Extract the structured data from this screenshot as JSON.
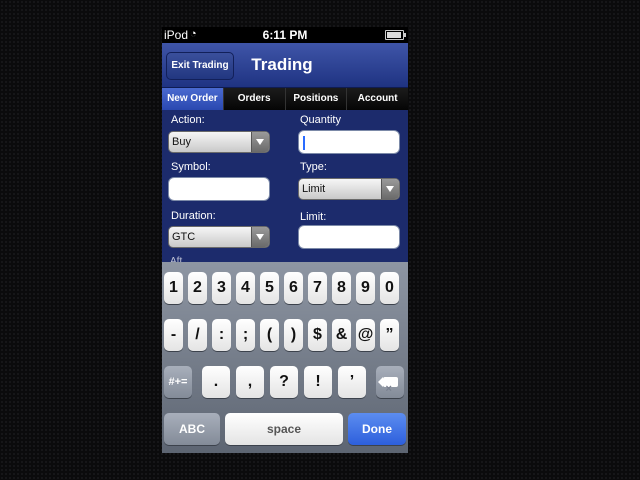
{
  "status_bar": {
    "carrier": "iPod",
    "time": "6:11 PM",
    "wifi_icon": "wifi-icon",
    "battery_icon": "battery-icon"
  },
  "nav": {
    "back_label": "Exit Trading",
    "title": "Trading"
  },
  "tabs": [
    {
      "label": "New Order",
      "active": true
    },
    {
      "label": "Orders",
      "active": false
    },
    {
      "label": "Positions",
      "active": false
    },
    {
      "label": "Account",
      "active": false
    }
  ],
  "form": {
    "action": {
      "label": "Action:",
      "value": "Buy"
    },
    "quantity": {
      "label": "Quantity",
      "value": ""
    },
    "symbol": {
      "label": "Symbol:",
      "value": ""
    },
    "type": {
      "label": "Type:",
      "value": "Limit"
    },
    "duration": {
      "label": "Duration:",
      "value": "GTC"
    },
    "limit": {
      "label": "Limit:",
      "value": ""
    },
    "peek_text": "Aft..."
  },
  "keyboard": {
    "row1": [
      "1",
      "2",
      "3",
      "4",
      "5",
      "6",
      "7",
      "8",
      "9",
      "0"
    ],
    "row2": [
      "-",
      "/",
      ":",
      ";",
      "(",
      ")",
      "$",
      "&",
      "@",
      "”"
    ],
    "row3": [
      ".",
      ",",
      "?",
      "!",
      "’"
    ],
    "shift_label": "#+=",
    "delete_icon": "delete-icon",
    "abc_label": "ABC",
    "space_label": "space",
    "done_label": "Done"
  },
  "colors": {
    "nav_blue": "#1f3382",
    "tab_active": "#2a48b0",
    "done_blue": "#2d5fdc"
  }
}
